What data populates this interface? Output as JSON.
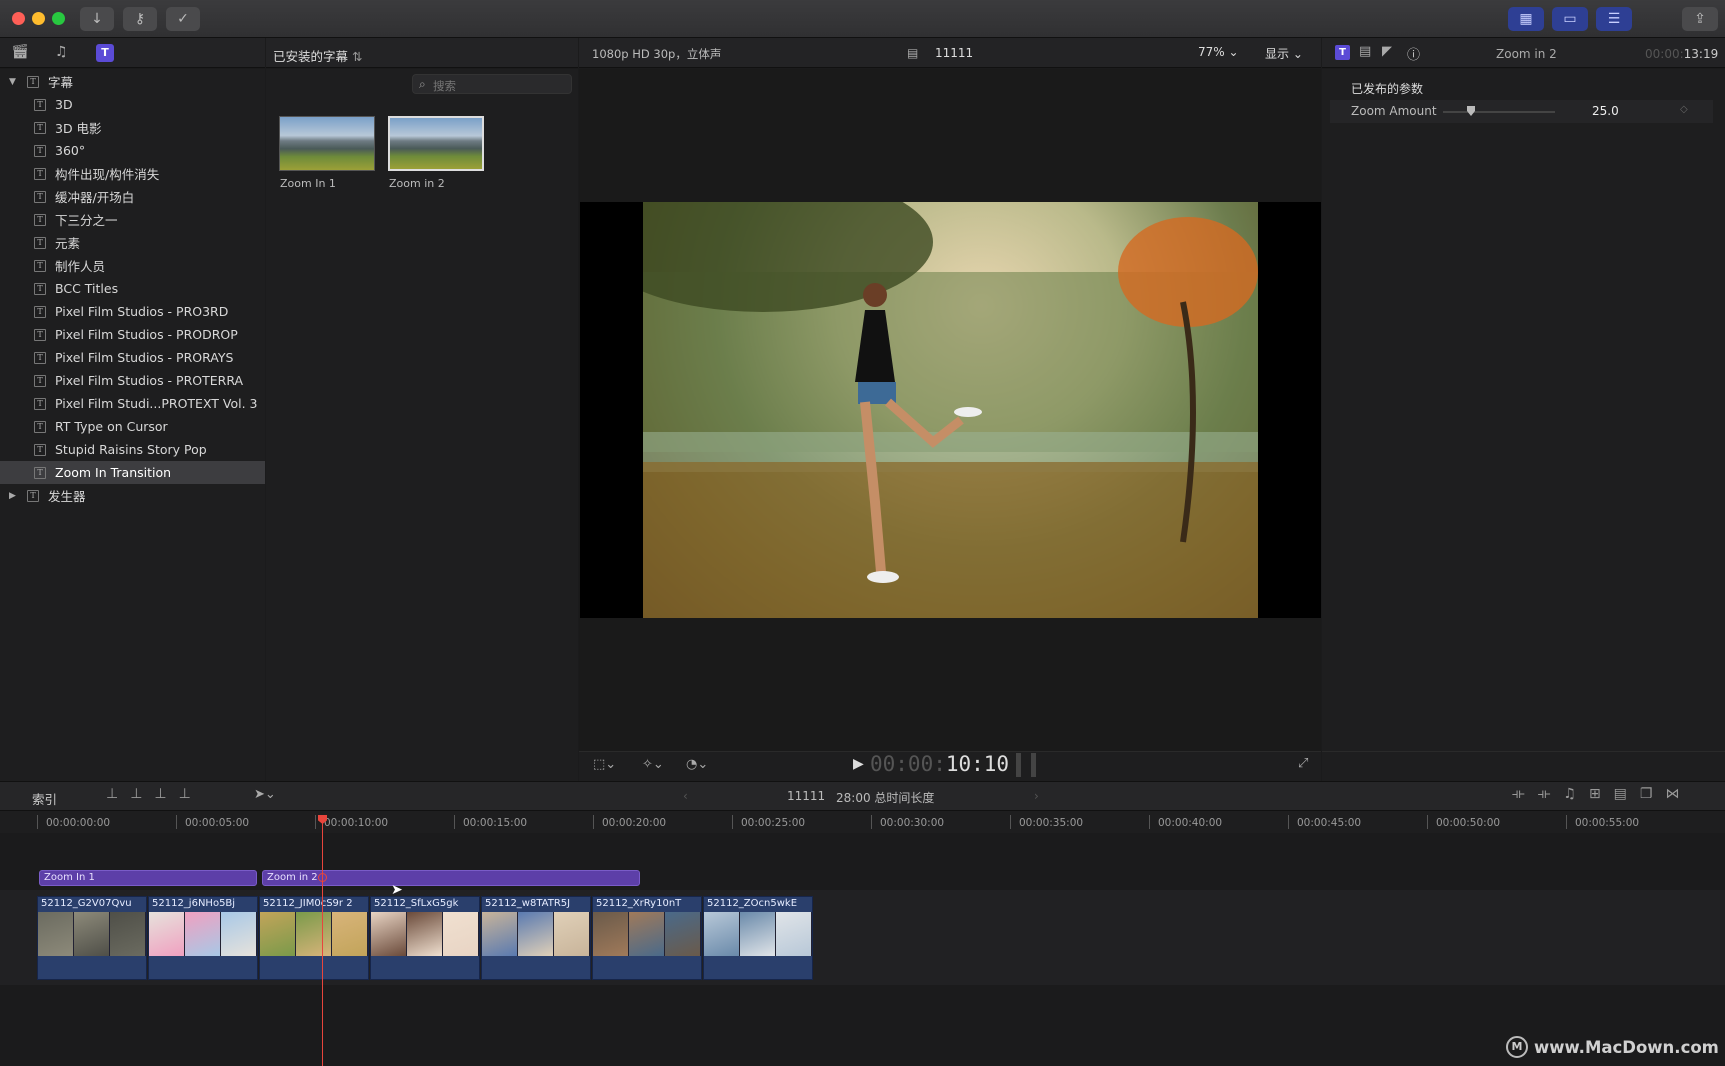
{
  "toolbar": {
    "import_icon": "download-icon",
    "keywords_icon": "key-icon",
    "check_icon": "checkmark-icon"
  },
  "browser": {
    "library_tabs": [
      "clapper-icon",
      "music-icon",
      "titles-icon"
    ],
    "filter_label": "已安装的字幕",
    "search_placeholder": "搜索",
    "categories": [
      {
        "label": "字幕",
        "expanded": true,
        "group": true
      },
      {
        "label": "3D"
      },
      {
        "label": "3D 电影"
      },
      {
        "label": "360°"
      },
      {
        "label": "构件出现/构件消失"
      },
      {
        "label": "缓冲器/开场白"
      },
      {
        "label": "下三分之一"
      },
      {
        "label": "元素"
      },
      {
        "label": "制作人员"
      },
      {
        "label": "BCC Titles"
      },
      {
        "label": "Pixel Film Studios - PRO3RD"
      },
      {
        "label": "Pixel Film Studios - PRODROP"
      },
      {
        "label": "Pixel Film Studios - PRORAYS"
      },
      {
        "label": "Pixel Film Studios - PROTERRA"
      },
      {
        "label": "Pixel Film Studi...PROTEXT Vol. 3"
      },
      {
        "label": "RT Type on Cursor"
      },
      {
        "label": "Stupid Raisins Story Pop"
      },
      {
        "label": "Zoom In Transition",
        "selected": true
      },
      {
        "label": "发生器",
        "group": true,
        "expanded": false
      }
    ],
    "items": [
      {
        "label": "Zoom In 1"
      },
      {
        "label": "Zoom in 2",
        "selected": true
      }
    ]
  },
  "viewer": {
    "format": "1080p HD 30p，立体声",
    "project": "11111",
    "zoom": "77%",
    "view_menu": "显示",
    "timecode_dim": "00:00:",
    "timecode": "10:10"
  },
  "inspector": {
    "title": "Zoom in 2",
    "duration_dim": "00:00:",
    "duration": "13:19",
    "section": "已发布的参数",
    "param_label": "Zoom Amount",
    "param_value": "25.0",
    "slider_fraction": 0.25
  },
  "timeline": {
    "index_label": "索引",
    "project": "11111",
    "duration_label": "28:00 总时间长度",
    "ruler": [
      "00:00:00:00",
      "00:00:05:00",
      "00:00:10:00",
      "00:00:15:00",
      "00:00:20:00",
      "00:00:25:00",
      "00:00:30:00",
      "00:00:35:00",
      "00:00:40:00",
      "00:00:45:00",
      "00:00:50:00",
      "00:00:55:00"
    ],
    "titles": [
      {
        "label": "Zoom In 1"
      },
      {
        "label": "Zoom in 2"
      }
    ],
    "clips": [
      "52112_G2V07Qvu",
      "52112_j6NHo5Bj",
      "52112_JIM0cS9r 2",
      "52112_SfLxG5gk",
      "52112_w8TATR5J",
      "52112_XrRy10nT",
      "52112_ZOcn5wkE"
    ]
  },
  "watermark": "www.MacDown.com"
}
